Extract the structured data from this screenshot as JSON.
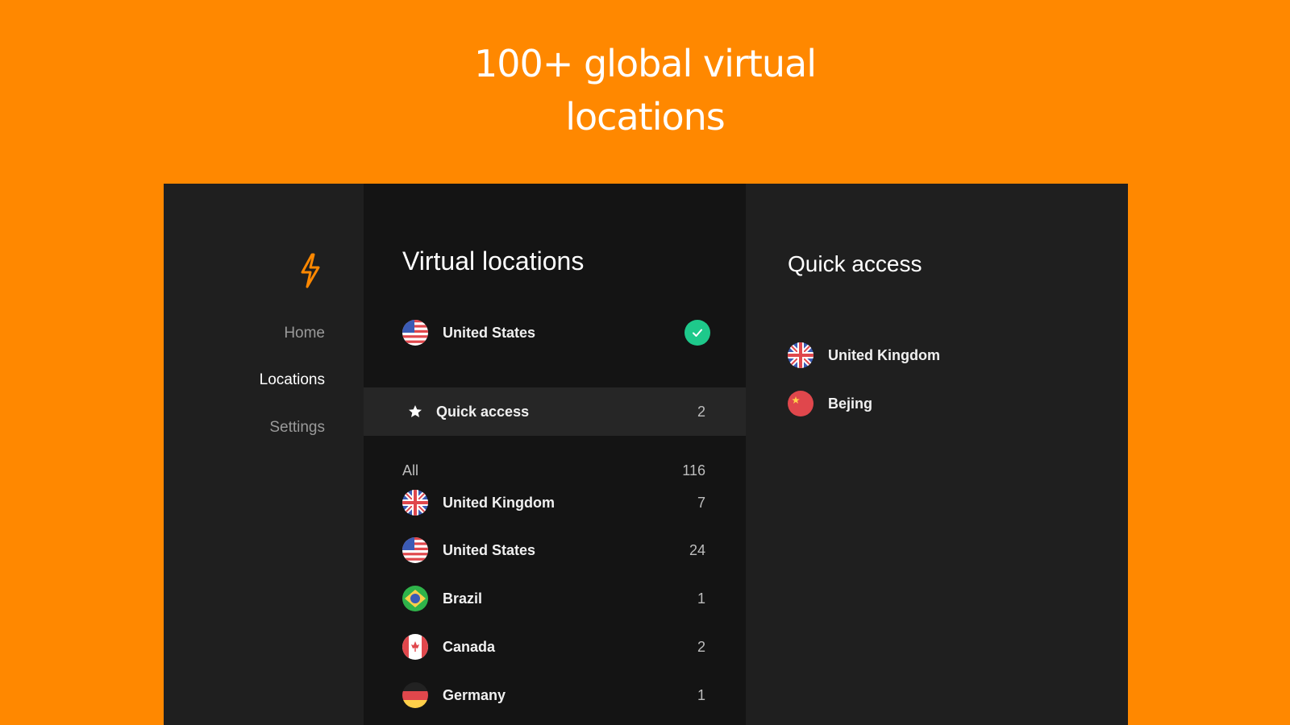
{
  "headline": {
    "line1": "100+ global virtual",
    "line2": "locations"
  },
  "brand": {
    "accent": "#FF8800",
    "logo_icon": "lightning-bolt-icon"
  },
  "nav": {
    "items": [
      {
        "label": "Home",
        "active": false
      },
      {
        "label": "Locations",
        "active": true
      },
      {
        "label": "Settings",
        "active": false
      }
    ]
  },
  "locations_panel": {
    "title": "Virtual locations",
    "connected": {
      "country": "United States",
      "flag": "us-flag-icon",
      "status_icon": "check-circle-icon",
      "status_color": "#1ec98b"
    },
    "quick_access": {
      "label": "Quick access",
      "count": "2",
      "icon": "star-icon"
    },
    "all": {
      "label": "All",
      "count": "116"
    },
    "countries": [
      {
        "name": "United Kingdom",
        "count": "7",
        "flag": "uk-flag-icon"
      },
      {
        "name": "United States",
        "count": "24",
        "flag": "us-flag-icon"
      },
      {
        "name": "Brazil",
        "count": "1",
        "flag": "brazil-flag-icon"
      },
      {
        "name": "Canada",
        "count": "2",
        "flag": "canada-flag-icon"
      },
      {
        "name": "Germany",
        "count": "1",
        "flag": "germany-flag-icon"
      }
    ]
  },
  "quick_access_panel": {
    "title": "Quick access",
    "items": [
      {
        "name": "United Kingdom",
        "flag": "uk-flag-icon"
      },
      {
        "name": "Bejing",
        "flag": "china-flag-icon"
      }
    ]
  }
}
